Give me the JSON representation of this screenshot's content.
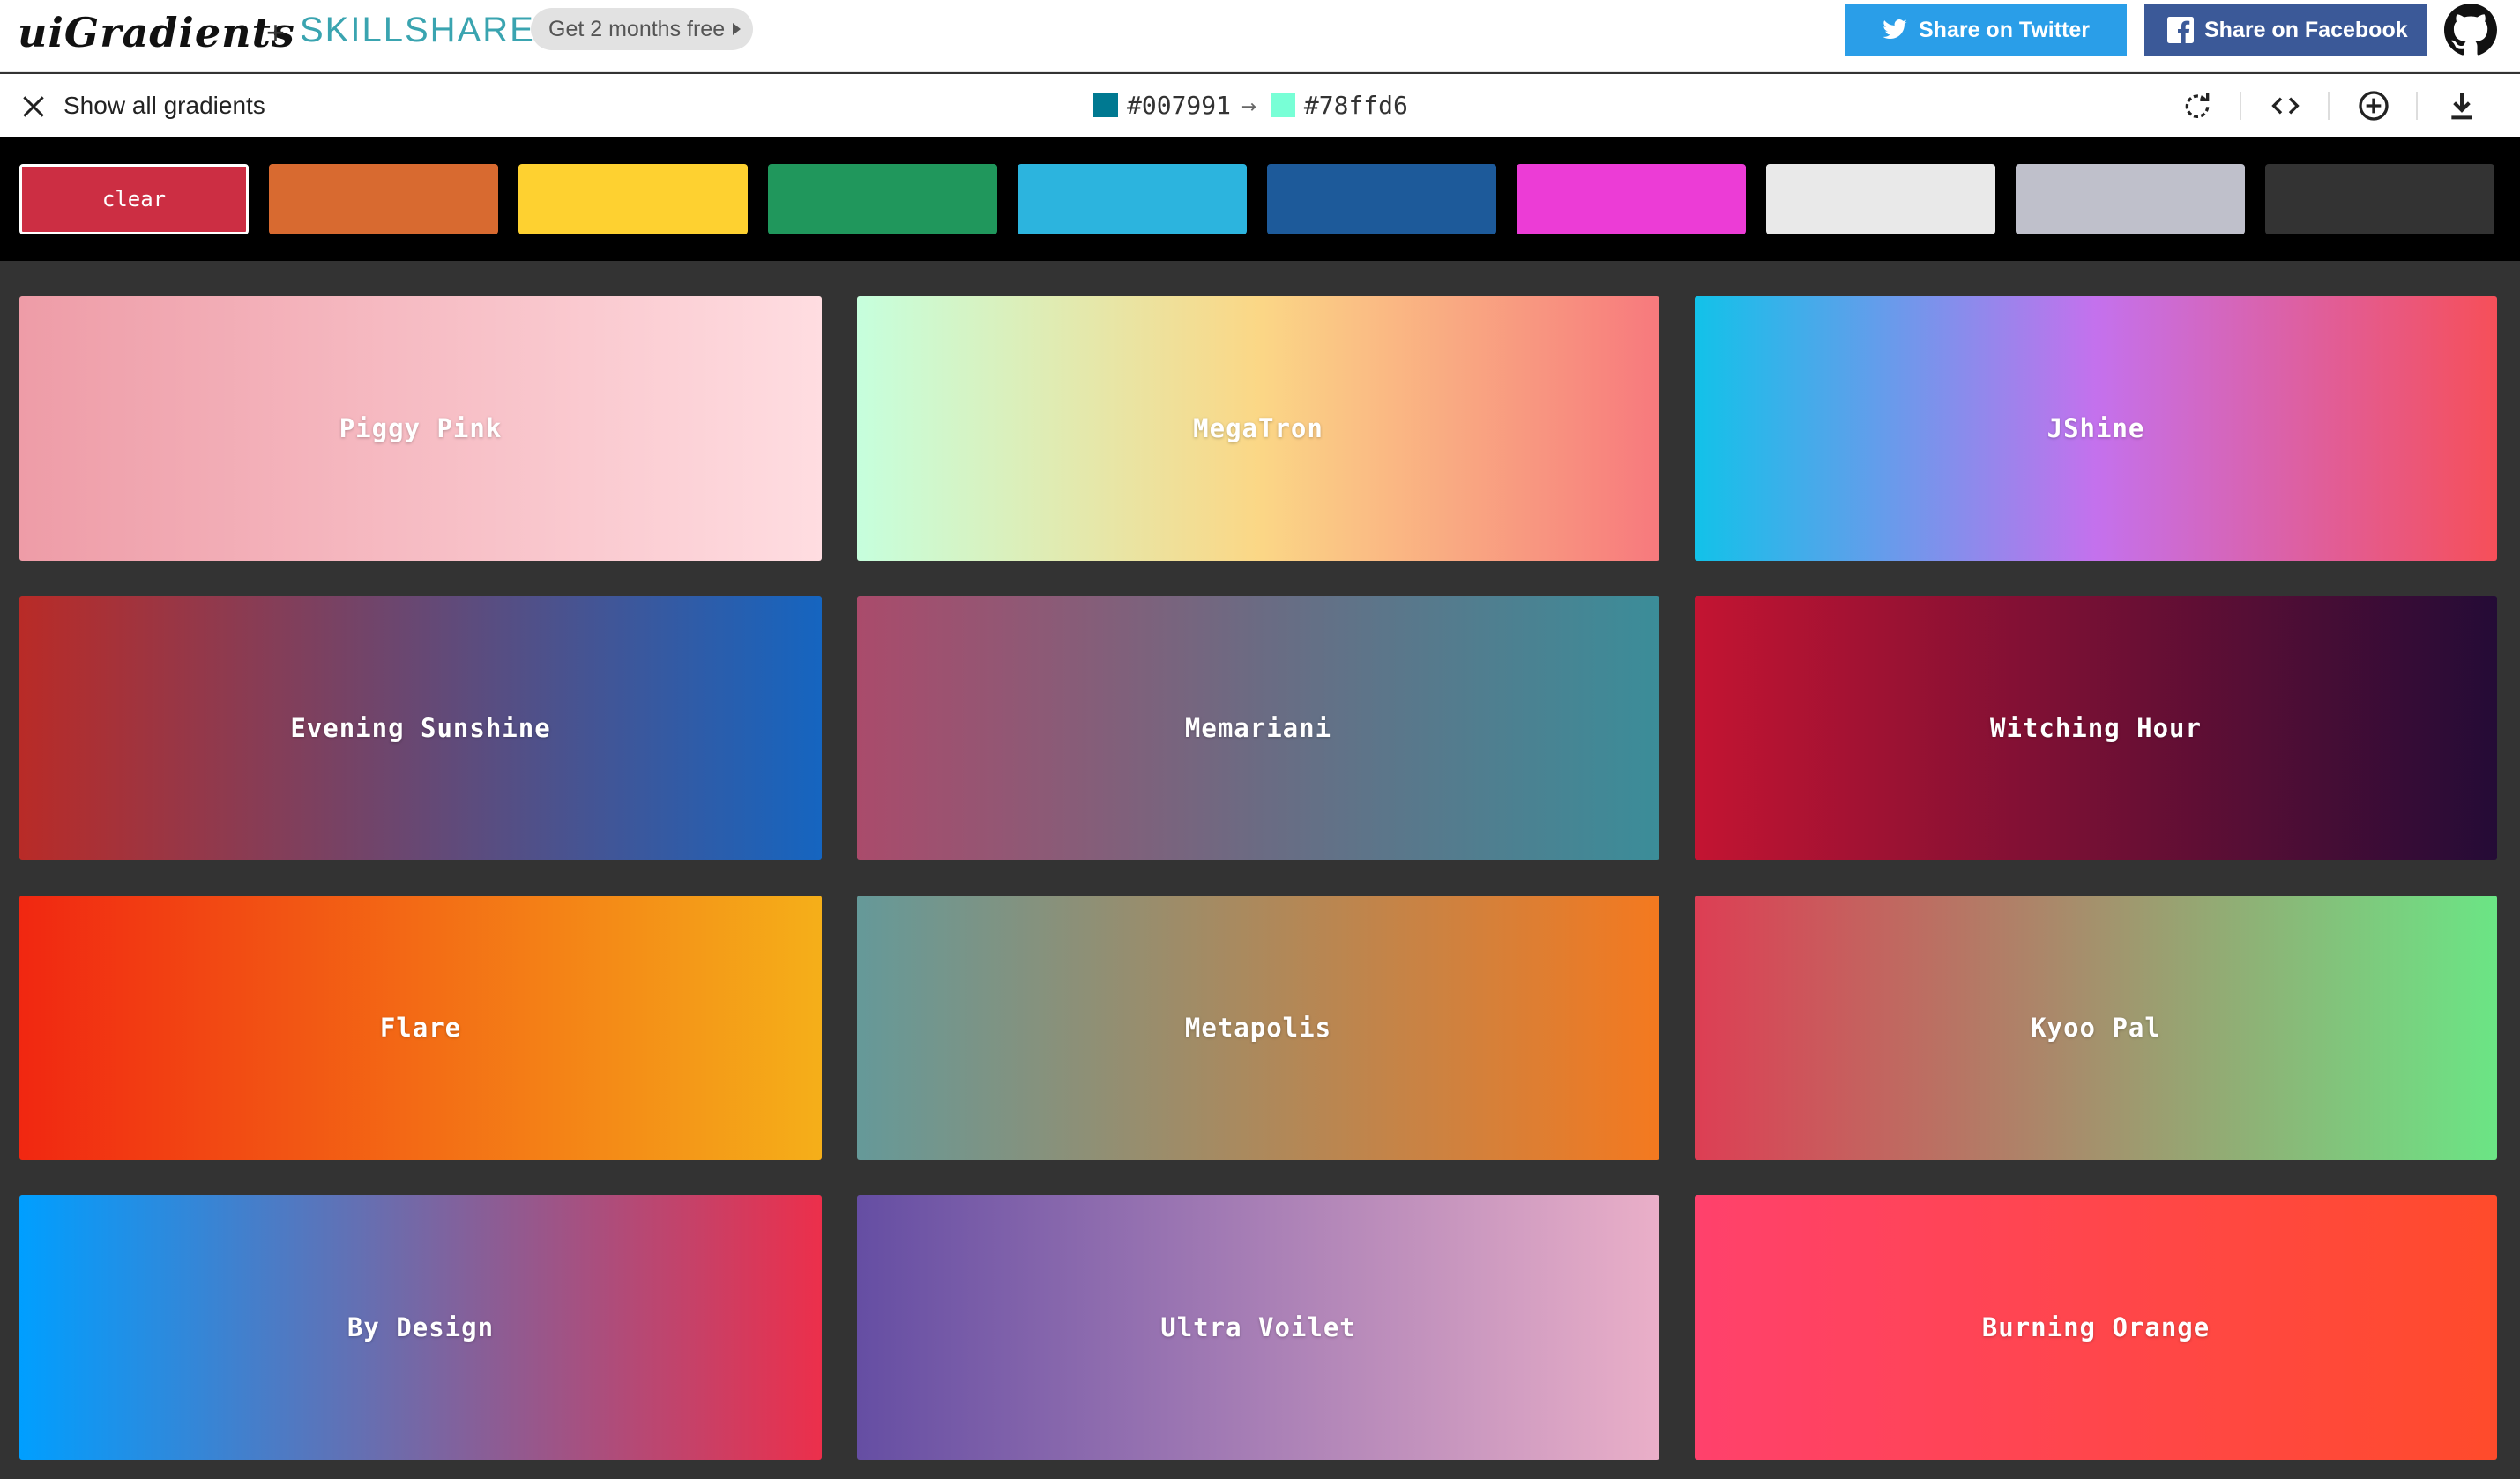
{
  "header": {
    "brand": "uiGradients",
    "plus": "+",
    "partner": "SKILLSHARE",
    "promo_label": "Get 2 months free",
    "twitter_label": "Share on Twitter",
    "facebook_label": "Share on Facebook",
    "github_icon": "github-icon"
  },
  "toolbar": {
    "show_all_label": "Show all gradients",
    "color_from": "#007991",
    "arrow": "→",
    "color_to": "#78ffd6",
    "tools": [
      "rotate-icon",
      "code-icon",
      "add-icon",
      "download-icon"
    ]
  },
  "filters": {
    "clear_label": "clear",
    "colors": [
      "#cc2e43",
      "#d86a30",
      "#fed130",
      "#20975c",
      "#2cb4de",
      "#1d5a9a",
      "#ec3cd6",
      "#e9e9e9",
      "#bfc0cb",
      "#333333"
    ]
  },
  "gradients": [
    {
      "name": "Piggy Pink",
      "from": "#ee9ca7",
      "to": "#ffdde1"
    },
    {
      "name": "MegaTron",
      "from": "#c6ffdd",
      "mid": "#fbd786",
      "to": "#f7797d"
    },
    {
      "name": "JShine",
      "from": "#12c2e9",
      "mid": "#c471ed",
      "to": "#f64f59"
    },
    {
      "name": "Evening Sunshine",
      "from": "#b92b27",
      "to": "#1565c0"
    },
    {
      "name": "Memariani",
      "from": "#aa4b6b",
      "mid": "#6b6b83",
      "to": "#3b8d99"
    },
    {
      "name": "Witching Hour",
      "from": "#c31432",
      "to": "#240b36"
    },
    {
      "name": "Flare",
      "from": "#f12711",
      "to": "#f5af19"
    },
    {
      "name": "Metapolis",
      "from": "#659999",
      "to": "#f4791f"
    },
    {
      "name": "Kyoo Pal",
      "from": "#dd3e54",
      "to": "#6be585"
    },
    {
      "name": "By Design",
      "from": "#009fff",
      "to": "#ec2f4b"
    },
    {
      "name": "Ultra Voilet",
      "from": "#654ea3",
      "to": "#eaafc8"
    },
    {
      "name": "Burning Orange",
      "from": "#ff416c",
      "to": "#ff4b2b"
    }
  ]
}
